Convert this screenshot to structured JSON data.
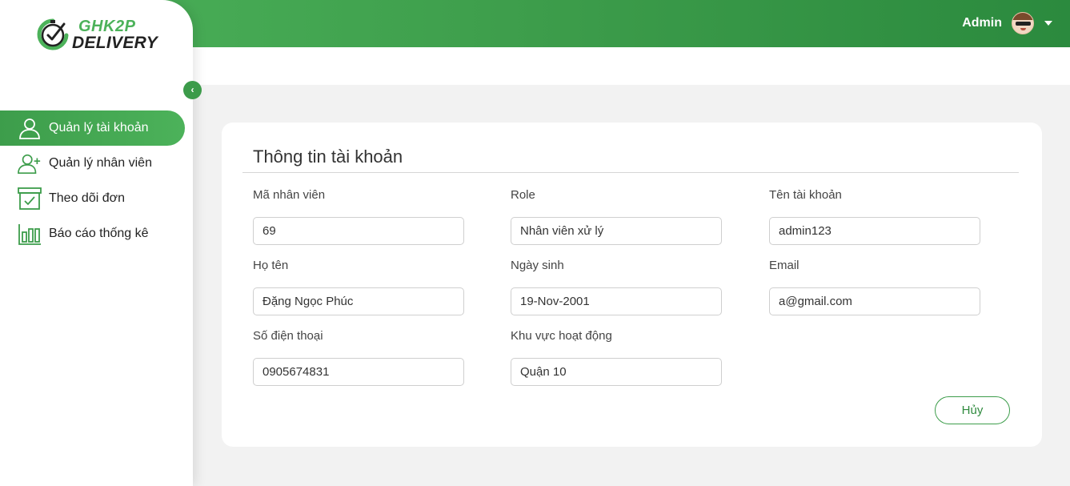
{
  "app": {
    "logo_line1": "GHK2P",
    "logo_line2": "DELIVERY",
    "accent_color": "#3d9d4b"
  },
  "header": {
    "user_name": "Admin",
    "avatar_icon": "user-avatar",
    "dropdown_icon": "caret-down-icon"
  },
  "sidebar": {
    "collapse_icon": "chevron-left-icon",
    "items": [
      {
        "label": "Quản lý tài khoản",
        "icon": "user-icon",
        "active": true
      },
      {
        "label": "Quản lý nhân viên",
        "icon": "user-plus-icon",
        "active": false
      },
      {
        "label": "Theo dõi đơn",
        "icon": "box-check-icon",
        "active": false
      },
      {
        "label": "Báo cáo thống kê",
        "icon": "bar-chart-icon",
        "active": false
      }
    ]
  },
  "form": {
    "title": "Thông tin tài khoản",
    "fields": {
      "employee_id": {
        "label": "Mã nhân viên",
        "value": "69"
      },
      "role": {
        "label": "Role",
        "value": "Nhân viên xử lý"
      },
      "username": {
        "label": "Tên tài khoản",
        "value": "admin123"
      },
      "full_name": {
        "label": "Họ tên",
        "value": "Đặng Ngọc Phúc"
      },
      "birth_date": {
        "label": "Ngày sinh",
        "value": "19-Nov-2001"
      },
      "email": {
        "label": "Email",
        "value": "a@gmail.com"
      },
      "phone": {
        "label": "Số điện thoại",
        "value": "0905674831"
      },
      "area": {
        "label": "Khu vực hoạt động",
        "value": "Quận 10"
      }
    },
    "cancel_label": "Hủy"
  }
}
